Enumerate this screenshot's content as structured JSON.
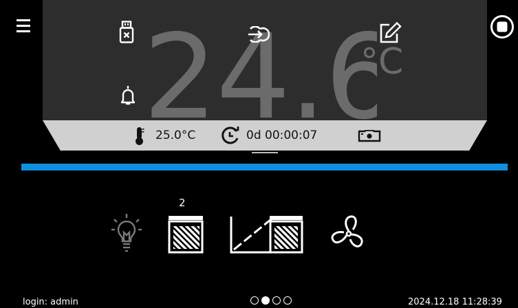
{
  "main": {
    "temperature_value": "24.6",
    "temperature_unit": "°C"
  },
  "info_bar": {
    "setpoint_temp": "25.0°C",
    "timer": "0d 00:00:07"
  },
  "progress": {
    "fraction": 1.0
  },
  "devices": {
    "program_count": "2"
  },
  "footer": {
    "login": "login: admin",
    "datetime": "2024.12.18  11:28:39",
    "pages_total": 4,
    "active_page": 2
  },
  "colors": {
    "background": "#000000",
    "panel": "#2d2d2d",
    "info_bar": "#d0d0d0",
    "accent_blue": "#0f8fe0",
    "temp_text": "#6b6b6b"
  },
  "icons": {
    "menu": "menu-icon",
    "usb": "usb-drive-icon",
    "login": "login-key-icon",
    "edit": "edit-icon",
    "stop": "stop-icon",
    "alarm": "alarm-bell-icon",
    "thermometer": "thermometer-icon",
    "timer": "timer-icon",
    "camera": "camera-icon",
    "light": "light-bulb-icon",
    "program": "program-icon",
    "ramp": "ramp-icon",
    "fan": "fan-icon"
  }
}
